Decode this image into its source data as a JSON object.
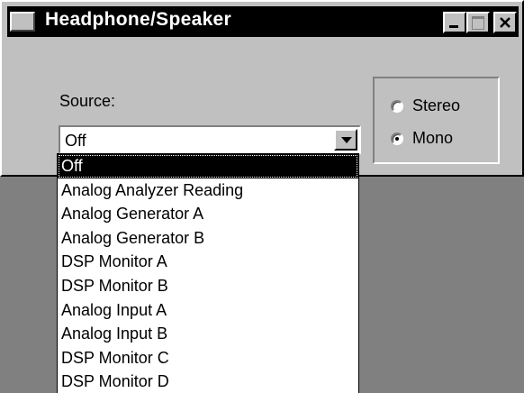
{
  "window": {
    "title": "Headphone/Speaker",
    "controls": [
      "minimize-icon",
      "maximize-icon",
      "close-icon"
    ]
  },
  "source": {
    "label": "Source:",
    "selected": "Off",
    "options": [
      "Off",
      "Analog Analyzer Reading",
      "Analog Generator A",
      "Analog Generator B",
      "DSP Monitor A",
      "DSP Monitor B",
      "Analog Input A",
      "Analog Input B",
      "DSP Monitor C",
      "DSP Monitor D"
    ]
  },
  "mode": {
    "options": [
      {
        "label": "Stereo",
        "checked": false
      },
      {
        "label": "Mono",
        "checked": true
      }
    ]
  }
}
